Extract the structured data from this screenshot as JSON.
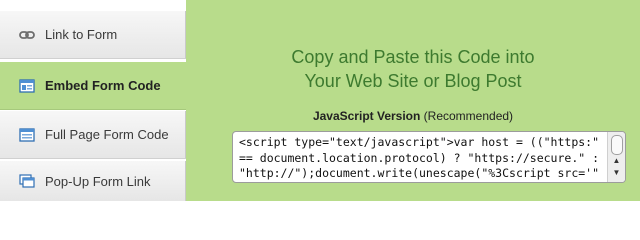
{
  "sidebar": {
    "items": [
      {
        "label": "Link to Form",
        "icon": "chain-link-icon",
        "active": false
      },
      {
        "label": "Embed Form Code",
        "icon": "embed-window-icon",
        "active": true
      },
      {
        "label": "Full Page Form Code",
        "icon": "page-form-icon",
        "active": false
      },
      {
        "label": "Pop-Up Form Link",
        "icon": "popup-window-icon",
        "active": false
      }
    ]
  },
  "main": {
    "heading_line1": "Copy and Paste this Code into",
    "heading_line2": "Your Web Site or Blog Post",
    "version_label": "JavaScript Version",
    "version_note": "(Recommended)",
    "code": "<script type=\"text/javascript\">var host = ((\"https:\"\n== document.location.protocol) ? \"https://secure.\" :\n\"http://\");document.write(unescape(\"%3Cscript src='\""
  },
  "colors": {
    "panel_green": "#b8dc8b",
    "heading_green": "#3d7a2f"
  }
}
